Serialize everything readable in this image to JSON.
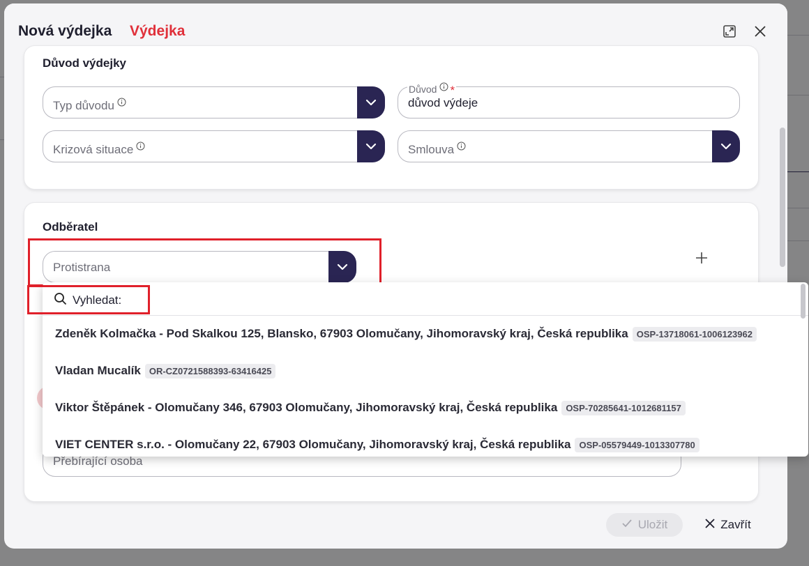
{
  "modal": {
    "title": "Nová výdejka",
    "subtitle": "Výdejka"
  },
  "reason_section": {
    "title": "Důvod výdejky",
    "reason_type_placeholder": "Typ důvodu",
    "reason_label": "Důvod",
    "reason_value": "důvod výdeje",
    "crisis_placeholder": "Krizová situace",
    "contract_placeholder": "Smlouva"
  },
  "recipient_section": {
    "title": "Odběratel",
    "counterparty_placeholder": "Protistrana",
    "receiver_placeholder": "Přebírající osoba"
  },
  "dropdown": {
    "search_label": "Vyhledat:",
    "options": [
      {
        "name": "Zdeněk Kolmačka - Pod Skalkou 125, Blansko, 67903 Olomučany, Jihomoravský kraj, Česká republika",
        "code": "OSP-13718061-1006123962"
      },
      {
        "name": "Vladan Mucalík",
        "code": "OR-CZ0721588393-63416425"
      },
      {
        "name": "Viktor Štěpánek - Olomučany 346, 67903 Olomučany, Jihomoravský kraj, Česká republika",
        "code": "OSP-70285641-1012681157"
      },
      {
        "name": "VIET CENTER s.r.o. - Olomučany 22, 67903 Olomučany, Jihomoravský kraj, Česká republika",
        "code": "OSP-05579449-1013307780"
      }
    ]
  },
  "footer": {
    "save_label": "Uložit",
    "close_label": "Zavřít"
  },
  "colors": {
    "accent": "#2a2553",
    "brand_red": "#e0303a",
    "highlight": "#e0202a"
  }
}
